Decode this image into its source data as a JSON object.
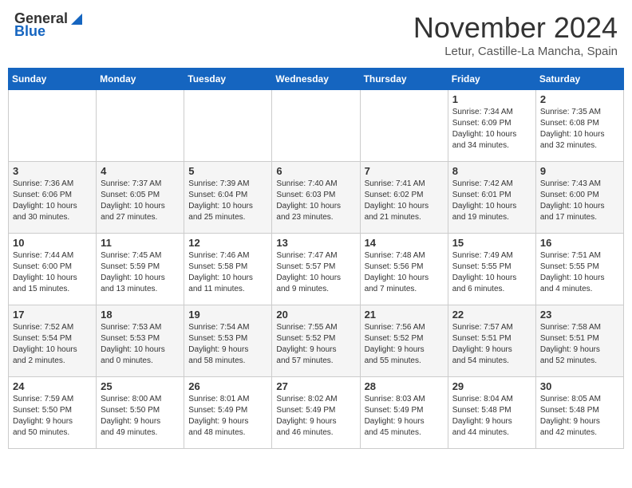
{
  "header": {
    "logo_general": "General",
    "logo_blue": "Blue",
    "month_year": "November 2024",
    "location": "Letur, Castille-La Mancha, Spain"
  },
  "days_of_week": [
    "Sunday",
    "Monday",
    "Tuesday",
    "Wednesday",
    "Thursday",
    "Friday",
    "Saturday"
  ],
  "weeks": [
    [
      {
        "day": "",
        "info": ""
      },
      {
        "day": "",
        "info": ""
      },
      {
        "day": "",
        "info": ""
      },
      {
        "day": "",
        "info": ""
      },
      {
        "day": "",
        "info": ""
      },
      {
        "day": "1",
        "info": "Sunrise: 7:34 AM\nSunset: 6:09 PM\nDaylight: 10 hours\nand 34 minutes."
      },
      {
        "day": "2",
        "info": "Sunrise: 7:35 AM\nSunset: 6:08 PM\nDaylight: 10 hours\nand 32 minutes."
      }
    ],
    [
      {
        "day": "3",
        "info": "Sunrise: 7:36 AM\nSunset: 6:06 PM\nDaylight: 10 hours\nand 30 minutes."
      },
      {
        "day": "4",
        "info": "Sunrise: 7:37 AM\nSunset: 6:05 PM\nDaylight: 10 hours\nand 27 minutes."
      },
      {
        "day": "5",
        "info": "Sunrise: 7:39 AM\nSunset: 6:04 PM\nDaylight: 10 hours\nand 25 minutes."
      },
      {
        "day": "6",
        "info": "Sunrise: 7:40 AM\nSunset: 6:03 PM\nDaylight: 10 hours\nand 23 minutes."
      },
      {
        "day": "7",
        "info": "Sunrise: 7:41 AM\nSunset: 6:02 PM\nDaylight: 10 hours\nand 21 minutes."
      },
      {
        "day": "8",
        "info": "Sunrise: 7:42 AM\nSunset: 6:01 PM\nDaylight: 10 hours\nand 19 minutes."
      },
      {
        "day": "9",
        "info": "Sunrise: 7:43 AM\nSunset: 6:00 PM\nDaylight: 10 hours\nand 17 minutes."
      }
    ],
    [
      {
        "day": "10",
        "info": "Sunrise: 7:44 AM\nSunset: 6:00 PM\nDaylight: 10 hours\nand 15 minutes."
      },
      {
        "day": "11",
        "info": "Sunrise: 7:45 AM\nSunset: 5:59 PM\nDaylight: 10 hours\nand 13 minutes."
      },
      {
        "day": "12",
        "info": "Sunrise: 7:46 AM\nSunset: 5:58 PM\nDaylight: 10 hours\nand 11 minutes."
      },
      {
        "day": "13",
        "info": "Sunrise: 7:47 AM\nSunset: 5:57 PM\nDaylight: 10 hours\nand 9 minutes."
      },
      {
        "day": "14",
        "info": "Sunrise: 7:48 AM\nSunset: 5:56 PM\nDaylight: 10 hours\nand 7 minutes."
      },
      {
        "day": "15",
        "info": "Sunrise: 7:49 AM\nSunset: 5:55 PM\nDaylight: 10 hours\nand 6 minutes."
      },
      {
        "day": "16",
        "info": "Sunrise: 7:51 AM\nSunset: 5:55 PM\nDaylight: 10 hours\nand 4 minutes."
      }
    ],
    [
      {
        "day": "17",
        "info": "Sunrise: 7:52 AM\nSunset: 5:54 PM\nDaylight: 10 hours\nand 2 minutes."
      },
      {
        "day": "18",
        "info": "Sunrise: 7:53 AM\nSunset: 5:53 PM\nDaylight: 10 hours\nand 0 minutes."
      },
      {
        "day": "19",
        "info": "Sunrise: 7:54 AM\nSunset: 5:53 PM\nDaylight: 9 hours\nand 58 minutes."
      },
      {
        "day": "20",
        "info": "Sunrise: 7:55 AM\nSunset: 5:52 PM\nDaylight: 9 hours\nand 57 minutes."
      },
      {
        "day": "21",
        "info": "Sunrise: 7:56 AM\nSunset: 5:52 PM\nDaylight: 9 hours\nand 55 minutes."
      },
      {
        "day": "22",
        "info": "Sunrise: 7:57 AM\nSunset: 5:51 PM\nDaylight: 9 hours\nand 54 minutes."
      },
      {
        "day": "23",
        "info": "Sunrise: 7:58 AM\nSunset: 5:51 PM\nDaylight: 9 hours\nand 52 minutes."
      }
    ],
    [
      {
        "day": "24",
        "info": "Sunrise: 7:59 AM\nSunset: 5:50 PM\nDaylight: 9 hours\nand 50 minutes."
      },
      {
        "day": "25",
        "info": "Sunrise: 8:00 AM\nSunset: 5:50 PM\nDaylight: 9 hours\nand 49 minutes."
      },
      {
        "day": "26",
        "info": "Sunrise: 8:01 AM\nSunset: 5:49 PM\nDaylight: 9 hours\nand 48 minutes."
      },
      {
        "day": "27",
        "info": "Sunrise: 8:02 AM\nSunset: 5:49 PM\nDaylight: 9 hours\nand 46 minutes."
      },
      {
        "day": "28",
        "info": "Sunrise: 8:03 AM\nSunset: 5:49 PM\nDaylight: 9 hours\nand 45 minutes."
      },
      {
        "day": "29",
        "info": "Sunrise: 8:04 AM\nSunset: 5:48 PM\nDaylight: 9 hours\nand 44 minutes."
      },
      {
        "day": "30",
        "info": "Sunrise: 8:05 AM\nSunset: 5:48 PM\nDaylight: 9 hours\nand 42 minutes."
      }
    ]
  ]
}
